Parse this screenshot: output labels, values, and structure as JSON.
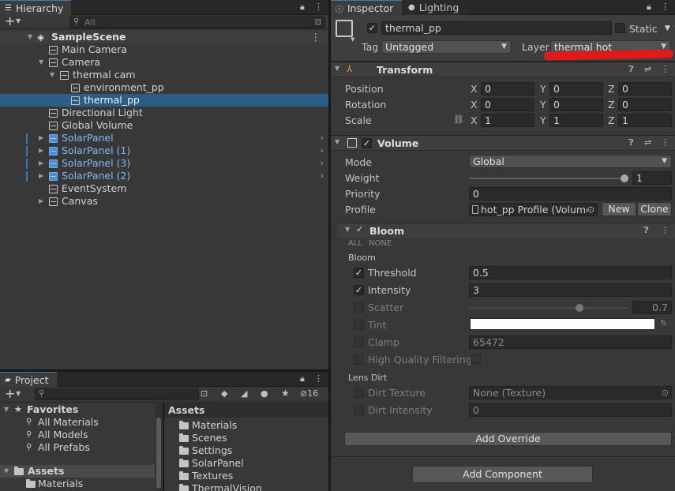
{
  "hierarchy": {
    "tab_label": "Hierarchy",
    "search_placeholder": "All",
    "scene_name": "SampleScene",
    "items": [
      {
        "label": "Main Camera"
      },
      {
        "label": "Camera"
      },
      {
        "label": "thermal cam"
      },
      {
        "label": "environment_pp"
      },
      {
        "label": "thermal_pp"
      },
      {
        "label": "Directional Light"
      },
      {
        "label": "Global Volume"
      },
      {
        "label": "SolarPanel"
      },
      {
        "label": "SolarPanel (1)"
      },
      {
        "label": "SolarPanel (3)"
      },
      {
        "label": "SolarPanel (2)"
      },
      {
        "label": "EventSystem"
      },
      {
        "label": "Canvas"
      }
    ]
  },
  "project": {
    "tab_label": "Project",
    "hidden_count": "16",
    "favorites_label": "Favorites",
    "favorites": [
      "All Materials",
      "All Models",
      "All Prefabs"
    ],
    "assets_label": "Assets",
    "assets_tree": [
      "Materials"
    ],
    "assets_header": "Assets",
    "folders": [
      "Materials",
      "Scenes",
      "Settings",
      "SolarPanel",
      "Textures",
      "ThermalVision"
    ]
  },
  "inspector": {
    "tab_inspector": "Inspector",
    "tab_lighting": "Lighting",
    "object_name": "thermal_pp",
    "static_label": "Static",
    "tag_label": "Tag",
    "tag_value": "Untagged",
    "layer_label": "Layer",
    "layer_value": "thermal hot",
    "transform": {
      "title": "Transform",
      "position_label": "Position",
      "rotation_label": "Rotation",
      "scale_label": "Scale",
      "x_label": "X",
      "y_label": "Y",
      "z_label": "Z",
      "position": [
        "0",
        "0",
        "0"
      ],
      "rotation": [
        "0",
        "0",
        "0"
      ],
      "scale": [
        "1",
        "1",
        "1"
      ]
    },
    "volume": {
      "title": "Volume",
      "mode_label": "Mode",
      "mode_value": "Global",
      "weight_label": "Weight",
      "weight_value": "1",
      "weight_fraction": 1.0,
      "priority_label": "Priority",
      "priority_value": "0",
      "profile_label": "Profile",
      "profile_value": "hot_pp Profile (Volume",
      "new_button": "New",
      "clone_button": "Clone"
    },
    "bloom": {
      "title": "Bloom",
      "all_label": "ALL",
      "none_label": "NONE",
      "section_bloom": "Bloom",
      "threshold_label": "Threshold",
      "threshold_value": "0.5",
      "intensity_label": "Intensity",
      "intensity_value": "3",
      "scatter_label": "Scatter",
      "scatter_value": "0.7",
      "scatter_fraction": 0.7,
      "tint_label": "Tint",
      "tint_color": "#ffffff",
      "clamp_label": "Clamp",
      "clamp_value": "65472",
      "hq_label": "High Quality Filtering",
      "section_lens": "Lens Dirt",
      "dirt_texture_label": "Dirt Texture",
      "dirt_texture_value": "None (Texture)",
      "dirt_intensity_label": "Dirt Intensity",
      "dirt_intensity_value": "0"
    },
    "add_override_button": "Add Override",
    "add_component_button": "Add Component"
  },
  "colors": {
    "selection": "#2c5d87",
    "prefab_blue": "#7fb8f2",
    "annotation_red": "#e01a1a"
  }
}
